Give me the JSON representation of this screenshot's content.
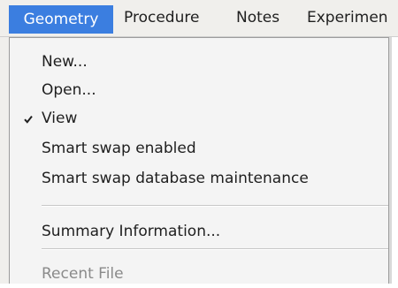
{
  "menubar": {
    "items": [
      "Geometry",
      "Procedure",
      "Notes",
      "Experimen"
    ]
  },
  "dropdown": {
    "items": [
      {
        "label": "New...",
        "checked": false,
        "disabled": false
      },
      {
        "label": "Open...",
        "checked": false,
        "disabled": false
      },
      {
        "label": "View",
        "checked": true,
        "disabled": false
      },
      {
        "label": "Smart swap enabled",
        "checked": false,
        "disabled": false
      },
      {
        "label": "Smart swap database maintenance",
        "checked": false,
        "disabled": false
      },
      {
        "label": "Summary Information...",
        "checked": false,
        "disabled": false
      },
      {
        "label": "Recent File",
        "checked": false,
        "disabled": true
      }
    ]
  },
  "colors": {
    "highlight": "#3b7ee0",
    "menu_bg": "#f4f4f4",
    "disabled_text": "#8a8a8a"
  }
}
